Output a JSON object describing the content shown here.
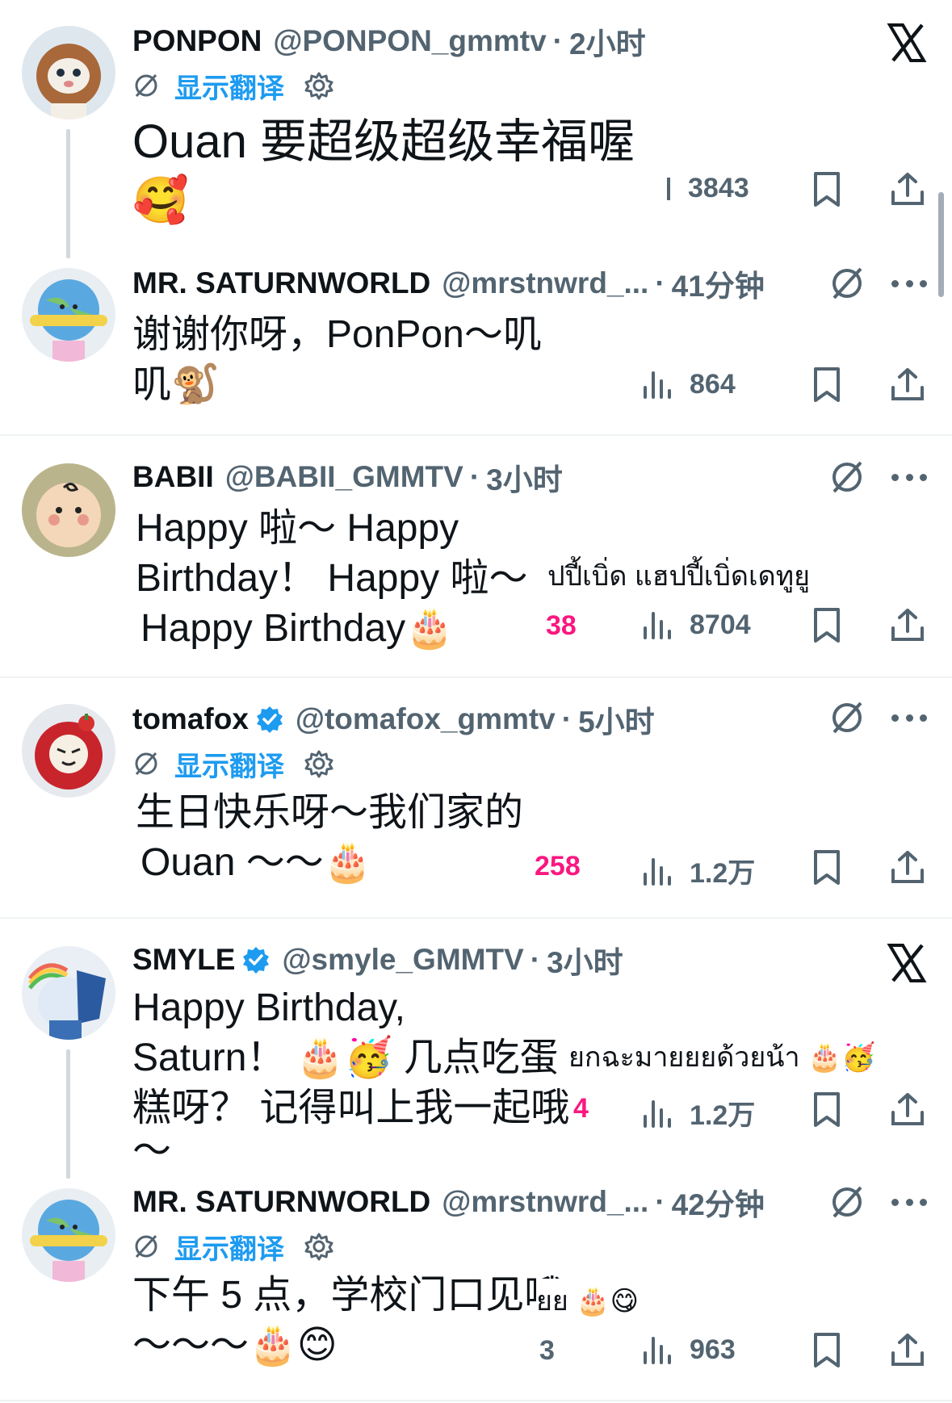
{
  "tweets": [
    {
      "name": "PONPON",
      "handle": "@PONPON_gmmtv",
      "time": "2小时",
      "translate": "显示翻译",
      "lines": [
        "Ouan 要超级超级幸福喔",
        "🥰"
      ],
      "views": "3843"
    },
    {
      "name": "MR. SATURNWORLD",
      "handle": "@mrstnwrd_...",
      "time": "41分钟",
      "lines": [
        "谢谢你呀，PonPon～叽",
        "叽🐒"
      ],
      "views": "864"
    },
    {
      "name": "BABII",
      "handle": "@BABII_GMMTV",
      "time": "3小时",
      "lines": [
        "Happy 啦～ Happy",
        "Birthday！ Happy 啦～",
        "Happy Birthday🎂"
      ],
      "ghost_text": "ปปี้เบิ่ด แฮปปี้เบิ่ดเดทูยู",
      "likes_partial": "38",
      "views": "8704"
    },
    {
      "name": "tomafox",
      "handle": "@tomafox_gmmtv",
      "time": "5小时",
      "translate": "显示翻译",
      "lines": [
        "生日快乐呀～我们家的",
        "Ouan ～～🎂"
      ],
      "likes": "258",
      "views": "1.2万"
    },
    {
      "name": "SMYLE",
      "handle": "@smyle_GMMTV",
      "time": "3小时",
      "lines": [
        "Happy Birthday,",
        "Saturn！ 🎂🥳 几点吃蛋",
        "糕呀？ 记得叫上我一起哦",
        "～"
      ],
      "ghost_text": "ยกฉะมายยยด้วยน้า 🎂🥳",
      "likes_partial": "4",
      "views": "1.2万"
    },
    {
      "name": "MR. SATURNWORLD",
      "handle": "@mrstnwrd_...",
      "time": "42分钟",
      "translate": "显示翻译",
      "lines": [
        "下午 5 点，学校门口见哦",
        "～～～🎂😊"
      ],
      "ghost_text": "ยย 🎂😋",
      "likes_partial": "3",
      "views": "963"
    }
  ],
  "icons": {
    "views": "bar-chart-icon",
    "bookmark": "bookmark-icon",
    "share": "share-icon",
    "more": "more-icon",
    "x": "x-logo-icon",
    "no_translate": "no-translate-icon",
    "gear": "gear-icon",
    "verified": "verified-badge-icon"
  },
  "colors": {
    "link": "#1d9bf0",
    "secondary": "#536471",
    "like": "#f91880",
    "verified": "#1d9bf0"
  }
}
